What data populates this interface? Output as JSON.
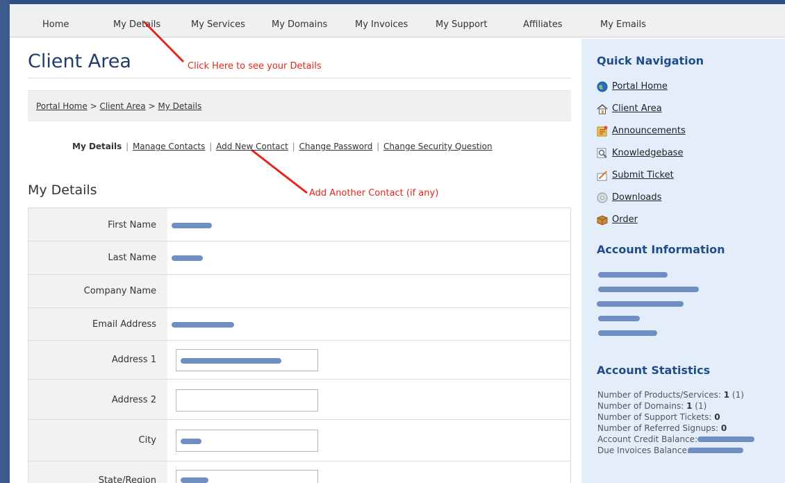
{
  "nav": {
    "items": [
      "Home",
      "My Details",
      "My Services",
      "My Domains",
      "My Invoices",
      "My Support",
      "Affiliates",
      "My Emails"
    ]
  },
  "main": {
    "title": "Client Area",
    "annotation_details": "Click Here to see your Details",
    "annotation_contact": "Add Another Contact (if any)",
    "breadcrumb": [
      "Portal Home",
      "Client Area",
      "My Details"
    ],
    "breadcrumb_sep": ">",
    "subnav": {
      "current": "My Details",
      "links": [
        "Manage Contacts",
        "Add New Contact",
        "Change Password",
        "Change Security Question"
      ],
      "sep": "|"
    },
    "section_title": "My Details",
    "fields": {
      "first_name": "First Name",
      "last_name": "Last Name",
      "company_name": "Company Name",
      "email_address": "Email Address",
      "address1": "Address 1",
      "address2": "Address 2",
      "city": "City",
      "state": "State/Region"
    }
  },
  "sidebar": {
    "quick_nav_title": "Quick Navigation",
    "quick_nav": [
      {
        "label": "Portal Home",
        "icon": "globe-icon"
      },
      {
        "label": "Client Area",
        "icon": "house-icon"
      },
      {
        "label": "Announcements",
        "icon": "announcement-icon"
      },
      {
        "label": "Knowledgebase",
        "icon": "magnifier-icon"
      },
      {
        "label": "Submit Ticket",
        "icon": "ticket-icon"
      },
      {
        "label": "Downloads",
        "icon": "disc-icon"
      },
      {
        "label": "Order",
        "icon": "box-icon"
      }
    ],
    "account_info_title": "Account Information",
    "account_stats_title": "Account Statistics",
    "stats": {
      "products_label": "Number of Products/Services:",
      "products_value": "1",
      "products_extra": "(1)",
      "domains_label": "Number of Domains:",
      "domains_value": "1",
      "domains_extra": "(1)",
      "tickets_label": "Number of Support Tickets:",
      "tickets_value": "0",
      "referrals_label": "Number of Referred Signups:",
      "referrals_value": "0",
      "credit_label": "Account Credit Balance:",
      "due_label": "Due Invoices Balance:"
    }
  },
  "colors": {
    "accent": "#1f4e87",
    "annotation": "#e2261c",
    "sidebar_bg": "#e3eefa",
    "redaction": "#6f8fc3"
  }
}
